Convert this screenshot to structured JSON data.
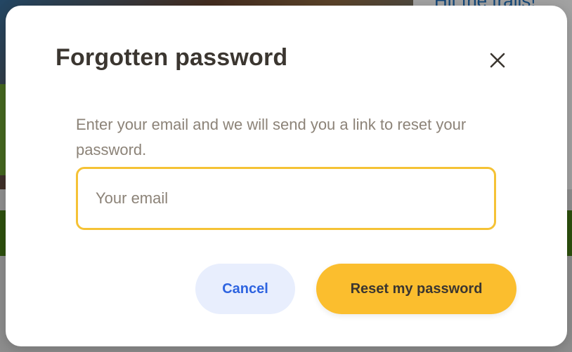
{
  "background": {
    "right_heading": "Hit the trails!"
  },
  "dialog": {
    "title": "Forgotten password",
    "close_icon": "close-icon",
    "description": "Enter your email and we will send you a link to reset your password.",
    "email_input": {
      "value": "",
      "placeholder": "Your email"
    },
    "cancel_label": "Cancel",
    "submit_label": "Reset my password"
  },
  "colors": {
    "accent": "#fbbe2e",
    "input_focus_border": "#f5c235",
    "cancel_bg": "#e8eefd",
    "cancel_text": "#2d63e0",
    "title_text": "#3b3630",
    "muted_text": "#8c8378"
  }
}
